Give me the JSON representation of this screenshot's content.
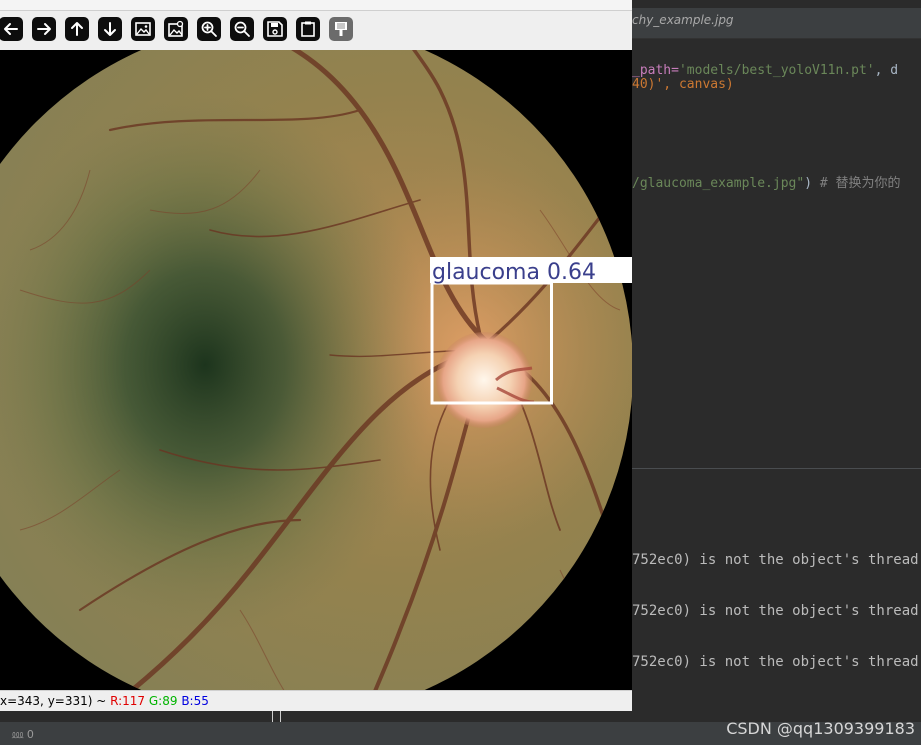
{
  "ide": {
    "tab_label": "chy_example.jpg",
    "code_line1": {
      "p1": "_path=",
      "p2": "'models/best_yoloV11n.pt'",
      "p3": ", d"
    },
    "code_line2": "40)', canvas)",
    "code_line3": {
      "p1": "/glaucoma_example.jpg\"",
      "p2": ")  ",
      "p3": "# 替换为你的"
    },
    "console_lines": [
      "752ec0) is not the object's thread",
      "752ec0) is not the object's thread",
      "752ec0) is not the object's thread"
    ],
    "status_left": "⅏ 0",
    "watermark": "CSDN @qq1309399183"
  },
  "viewer": {
    "toolbar": [
      {
        "name": "pan-left-button",
        "icon": "arrow-left-icon"
      },
      {
        "name": "pan-right-button",
        "icon": "arrow-right-icon"
      },
      {
        "name": "pan-up-button",
        "icon": "arrow-up-icon"
      },
      {
        "name": "pan-down-button",
        "icon": "arrow-down-icon"
      },
      {
        "name": "fit-image-button",
        "icon": "image-icon"
      },
      {
        "name": "original-size-button",
        "icon": "image-zoom-icon"
      },
      {
        "name": "zoom-in-button",
        "icon": "zoom-in-icon"
      },
      {
        "name": "zoom-out-button",
        "icon": "zoom-out-icon"
      },
      {
        "name": "save-button",
        "icon": "save-icon"
      },
      {
        "name": "copy-clipboard-button",
        "icon": "clipboard-icon"
      },
      {
        "name": "properties-button",
        "icon": "brush-icon"
      }
    ],
    "detection": {
      "label": "glaucoma 0.64"
    },
    "status": {
      "coords": "x=343, y=331) ~ ",
      "r": "R:117",
      "g": "G:89",
      "b": "B:55"
    }
  }
}
